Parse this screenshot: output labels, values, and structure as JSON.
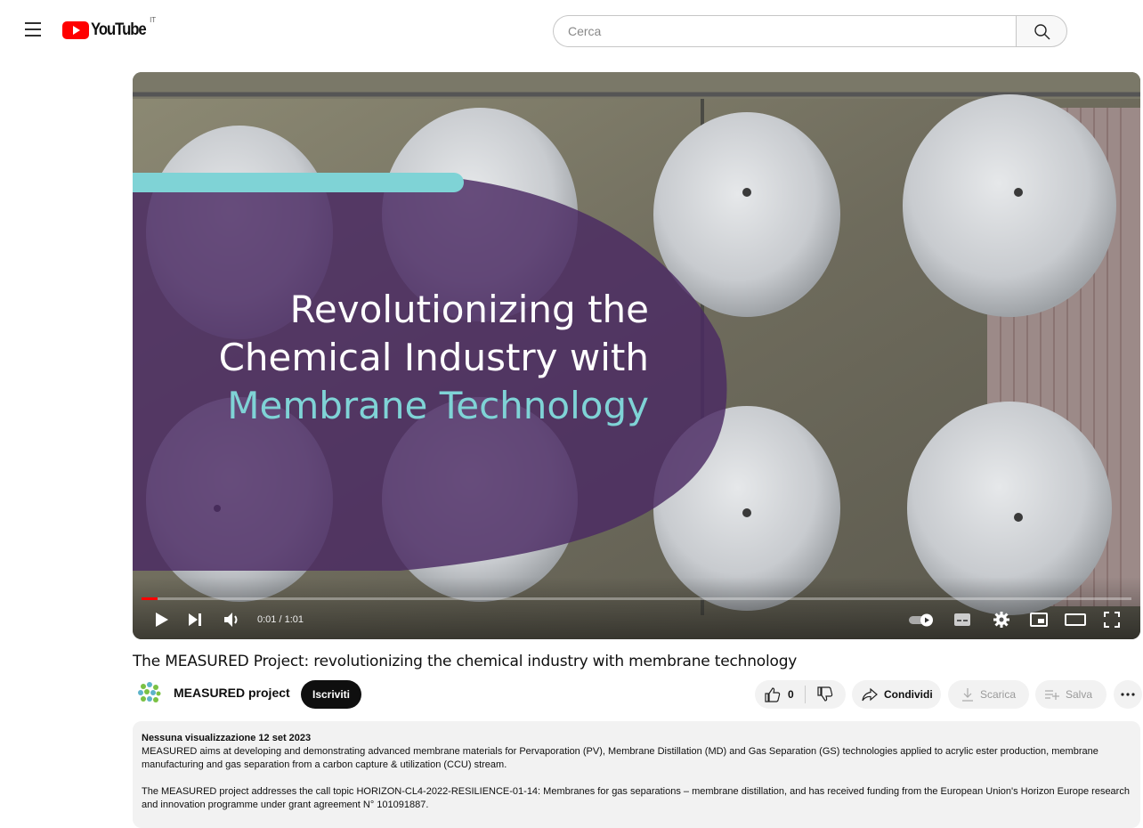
{
  "header": {
    "logo_text": "YouTube",
    "country_code": "IT",
    "search_placeholder": "Cerca"
  },
  "player": {
    "overlay_lines": [
      "Revolutionizing the",
      "Chemical Industry with",
      "Membrane Technology"
    ],
    "time": "0:01 / 1:01",
    "progress": 0.016
  },
  "video": {
    "title": "The MEASURED Project: revolutionizing the chemical industry with membrane technology",
    "channel": "MEASURED project",
    "subscribe_label": "Iscriviti",
    "like_count": "0",
    "share_label": "Condividi",
    "download_label": "Scarica",
    "save_label": "Salva"
  },
  "description": {
    "meta": "Nessuna visualizzazione  12 set 2023",
    "para1": "MEASURED aims at developing and demonstrating advanced membrane materials for Pervaporation (PV), Membrane Distillation (MD) and Gas Separation (GS) technologies applied to acrylic ester production, membrane manufacturing and gas separation from a carbon capture & utilization (CCU) stream.",
    "para2": "The MEASURED project addresses the call topic HORIZON-CL4-2022-RESILIENCE-01-14: Membranes for gas separations – membrane distillation, and has received funding from the European Union's Horizon Europe research and innovation programme under grant agreement N° 101091887."
  },
  "colors": {
    "brand_red": "#ff0000",
    "overlay_purple": "#4b2a63",
    "overlay_cyan": "#7fd3d6"
  }
}
